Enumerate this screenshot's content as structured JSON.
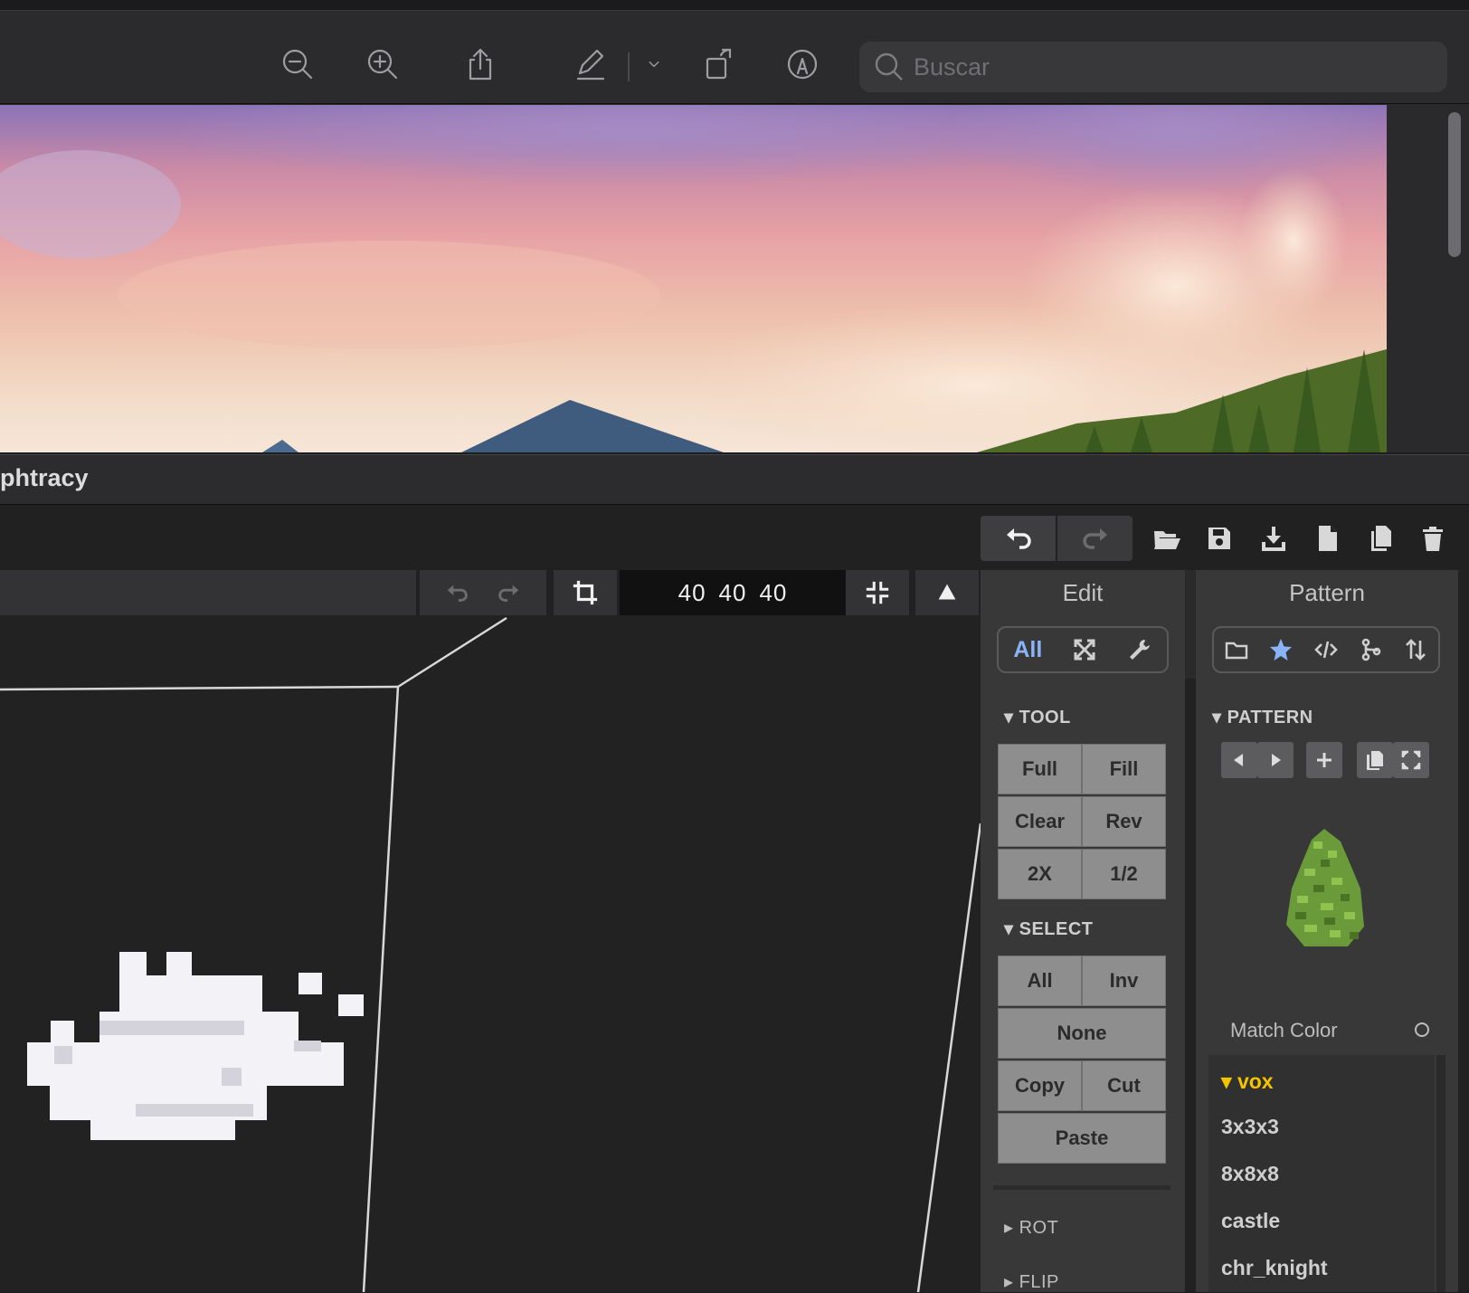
{
  "preview": {
    "search_placeholder": "Buscar",
    "toolbar_icons": [
      "zoom-out-icon",
      "zoom-in-icon",
      "share-icon",
      "markup-pen-icon",
      "chevron-down-icon",
      "rotate-icon",
      "annotate-icon"
    ]
  },
  "app": {
    "title": "phtracy"
  },
  "viewport": {
    "dims": [
      "40",
      "40",
      "40"
    ]
  },
  "edit_panel": {
    "header": "Edit",
    "segment_all": "All",
    "tool_section": "TOOL",
    "tool_buttons": [
      "Full",
      "Fill",
      "Clear",
      "Rev",
      "2X",
      "1/2"
    ],
    "select_section": "SELECT",
    "select_buttons": [
      "All",
      "Inv",
      "None",
      "Copy",
      "Cut",
      "Paste"
    ],
    "rot_section": "ROT",
    "flip_section": "FLIP"
  },
  "pattern_panel": {
    "header": "Pattern",
    "pattern_section": "PATTERN",
    "match_color": "Match Color",
    "list_header": "vox",
    "items": [
      "3x3x3",
      "8x8x8",
      "castle",
      "chr_knight"
    ]
  },
  "colors": {
    "accent_blue": "#8ab4f8",
    "folder_yellow": "#f5c400",
    "voxel_green": "#6a9a3a"
  }
}
